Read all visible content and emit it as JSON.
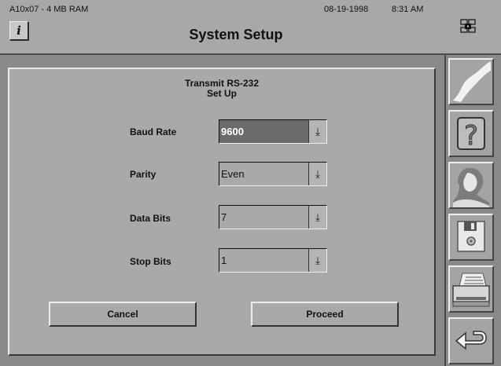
{
  "header": {
    "system_info": "A10x07 - 4 MB RAM",
    "date": "08-19-1998",
    "time": "8:31 AM",
    "title": "System Setup",
    "info_button_label": "i"
  },
  "panel": {
    "title_line1": "Transmit RS-232",
    "title_line2": "Set Up",
    "fields": [
      {
        "label": "Baud Rate",
        "value": "9600"
      },
      {
        "label": "Parity",
        "value": "Even"
      },
      {
        "label": "Data Bits",
        "value": "7"
      },
      {
        "label": "Stop Bits",
        "value": "1"
      }
    ],
    "dropdown_arrow": "⤓",
    "cancel_label": "Cancel",
    "proceed_label": "Proceed"
  },
  "toolbar": {
    "icons": [
      "curve-icon",
      "help-icon",
      "operator-icon",
      "floppy-disk-icon",
      "printer-icon",
      "return-arrow-icon"
    ]
  },
  "colors": {
    "background": "#8a8a8a",
    "panel": "#a9a9a9",
    "selected_field": "#6b6b6b"
  }
}
